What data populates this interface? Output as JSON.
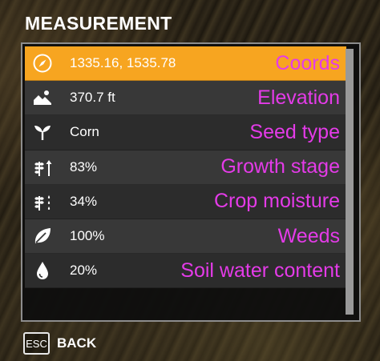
{
  "header": {
    "title": "MEASUREMENT"
  },
  "rows": [
    {
      "icon": "compass-icon",
      "value": "1335.16, 1535.78",
      "label": "Coords",
      "selected": true
    },
    {
      "icon": "terrain-icon",
      "value": "370.7 ft",
      "label": "Elevation"
    },
    {
      "icon": "sprout-icon",
      "value": "Corn",
      "label": "Seed type"
    },
    {
      "icon": "growth-stage-icon",
      "value": "83%",
      "label": "Growth stage"
    },
    {
      "icon": "crop-moisture-icon",
      "value": "34%",
      "label": "Crop moisture"
    },
    {
      "icon": "leaf-icon",
      "value": "100%",
      "label": "Weeds"
    },
    {
      "icon": "water-drop-icon",
      "value": "20%",
      "label": "Soil water content"
    }
  ],
  "footer": {
    "key_label": "ESC",
    "back_label": "BACK"
  },
  "colors": {
    "accent": "#f7a520",
    "label_magenta": "#e43be8",
    "text": "#ffffff"
  }
}
